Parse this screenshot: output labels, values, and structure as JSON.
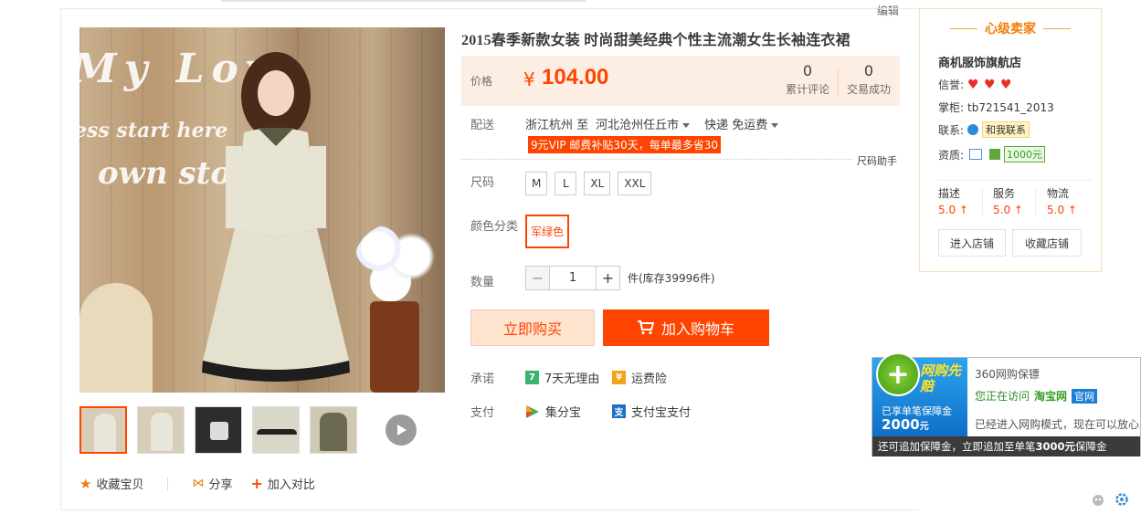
{
  "edit_link": "编辑",
  "product": {
    "title": "2015春季新款女装 时尚甜美经典个性主流潮女生长袖连衣裙",
    "image_text": [
      "My Love",
      "ess start here",
      "own story"
    ]
  },
  "price": {
    "label": "价格",
    "currency": "¥",
    "value": "104.00",
    "reviews_count": "0",
    "reviews_label": "累计评论",
    "sales_count": "0",
    "sales_label": "交易成功"
  },
  "shipping": {
    "label": "配送",
    "from": "浙江杭州 至",
    "to": "河北沧州任丘市",
    "method": "快递 免运费",
    "vip_promo": "9元VIP 邮费补贴30天，每单最多省30"
  },
  "size_helper": "尺码助手",
  "size": {
    "label": "尺码",
    "options": [
      "M",
      "L",
      "XL",
      "XXL"
    ]
  },
  "color": {
    "label": "颜色分类",
    "options": [
      "军绿色"
    ]
  },
  "quantity": {
    "label": "数量",
    "minus": "−",
    "value": "1",
    "plus": "+",
    "stock_text": "件(库存39996件)"
  },
  "actions": {
    "buy_now": "立即购买",
    "add_cart": "加入购物车"
  },
  "promise": {
    "label": "承诺",
    "items": [
      "7天无理由",
      "运费险"
    ]
  },
  "payment": {
    "label": "支付",
    "items": [
      "集分宝",
      "支付宝支付"
    ]
  },
  "bottom": {
    "favorite": "收藏宝贝",
    "share": "分享",
    "compare": "加入对比"
  },
  "seller": {
    "header": "心级卖家",
    "shop_name": "商机服饰旗航店",
    "reputation_label": "信誉:",
    "keeper_label": "掌柜:",
    "keeper_value": "tb721541_2013",
    "contact_label": "联系:",
    "contact_button": "和我联系",
    "qualification_label": "资质:",
    "deposit": "1000元",
    "scores": [
      {
        "label": "描述",
        "value": "5.0"
      },
      {
        "label": "服务",
        "value": "5.0"
      },
      {
        "label": "物流",
        "value": "5.0"
      }
    ],
    "enter_shop": "进入店铺",
    "favorite_shop": "收藏店铺"
  },
  "popup360": {
    "logo_big": "网购先赔",
    "logo_small": "已享单笔保障金",
    "logo_amount": "2000",
    "logo_unit": "元",
    "title": "360网购保镖",
    "visiting": "您正在访问",
    "site": "淘宝网",
    "official": "官网",
    "entered": "已经进入网购模式，现在可以放心购物",
    "footer_prefix": "还可追加保障金，立即追加至单笔",
    "footer_amount": "3000元",
    "footer_suffix": "保障金"
  },
  "colors": {
    "accent": "#ff4400",
    "price_bg": "#fdeee3",
    "seller_header": "#f07d0a"
  }
}
